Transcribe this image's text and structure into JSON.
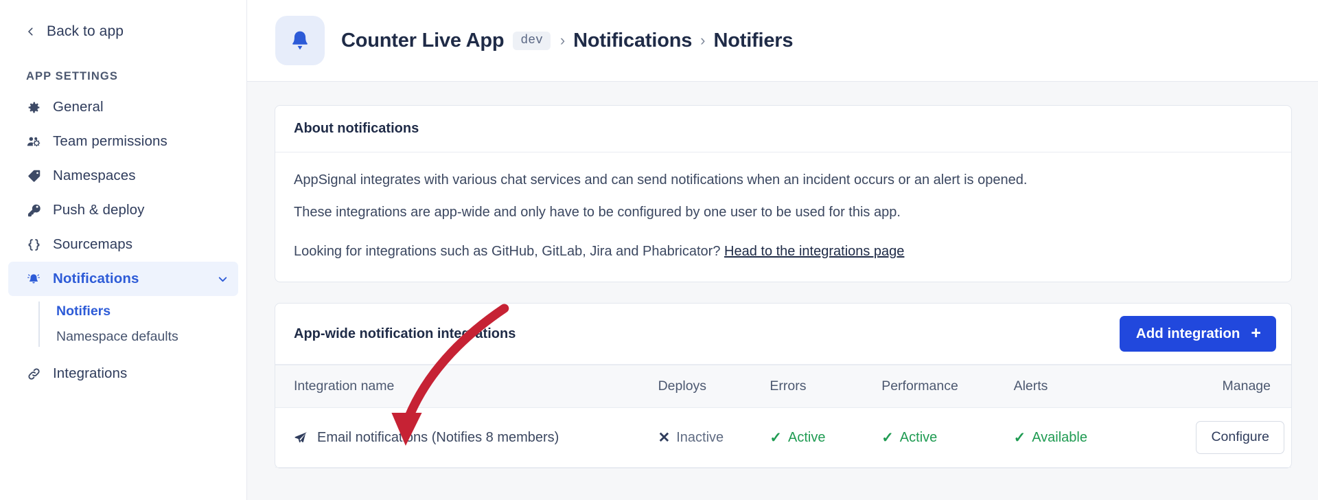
{
  "sidebar": {
    "back": {
      "label": "Back to app",
      "icon": "chevron-left-icon"
    },
    "section_title": "APP SETTINGS",
    "items": [
      {
        "label": "General",
        "icon": "gear-icon",
        "active": false
      },
      {
        "label": "Team permissions",
        "icon": "people-gear-icon",
        "active": false
      },
      {
        "label": "Namespaces",
        "icon": "tag-icon",
        "active": false
      },
      {
        "label": "Push & deploy",
        "icon": "key-icon",
        "active": false
      },
      {
        "label": "Sourcemaps",
        "icon": "braces-icon",
        "active": false
      },
      {
        "label": "Notifications",
        "icon": "bell-alert-icon",
        "active": true
      },
      {
        "label": "Integrations",
        "icon": "link-icon",
        "active": false
      }
    ],
    "sub_items": [
      {
        "label": "Notifiers",
        "current": true
      },
      {
        "label": "Namespace defaults",
        "current": false
      }
    ],
    "expand_icon": "chevron-down-icon"
  },
  "header": {
    "app_icon": "bell-icon",
    "app_name": "Counter Live App",
    "environment": "dev",
    "separator": "›",
    "crumb_2": "Notifications",
    "crumb_3": "Notifiers"
  },
  "about_card": {
    "title": "About notifications",
    "paragraph_1": "AppSignal integrates with various chat services and can send notifications when an incident occurs or an alert is opened.",
    "paragraph_2": "These integrations are app-wide and only have to be configured by one user to be used for this app.",
    "paragraph_3_prefix": "Looking for integrations such as GitHub, GitLab, Jira and Phabricator? ",
    "paragraph_3_link": "Head to the integrations page"
  },
  "integrations_card": {
    "title": "App-wide notification integrations",
    "add_button": {
      "label": "Add integration",
      "icon": "plus-icon"
    },
    "columns": [
      "Integration name",
      "Deploys",
      "Errors",
      "Performance",
      "Alerts",
      "Manage"
    ],
    "rows": [
      {
        "icon": "paper-plane-icon",
        "name": "Email notifications (Notifies 8 members)",
        "deploys": {
          "label": "Inactive",
          "state": "off",
          "glyph": "✕"
        },
        "errors": {
          "label": "Active",
          "state": "ok",
          "glyph": "✓"
        },
        "performance": {
          "label": "Active",
          "state": "ok",
          "glyph": "✓"
        },
        "alerts": {
          "label": "Available",
          "state": "ok",
          "glyph": "✓"
        },
        "manage_label": "Configure"
      }
    ]
  },
  "annotation": {
    "type": "arrow",
    "color": "#c62234",
    "points_to": "integration-name-cell"
  },
  "colors": {
    "accent": "#2148dd",
    "link": "#2d5bd7",
    "success": "#1f9b52",
    "muted": "#5f6b82",
    "page_bg": "#f6f7f9",
    "annotation": "#c62234"
  }
}
